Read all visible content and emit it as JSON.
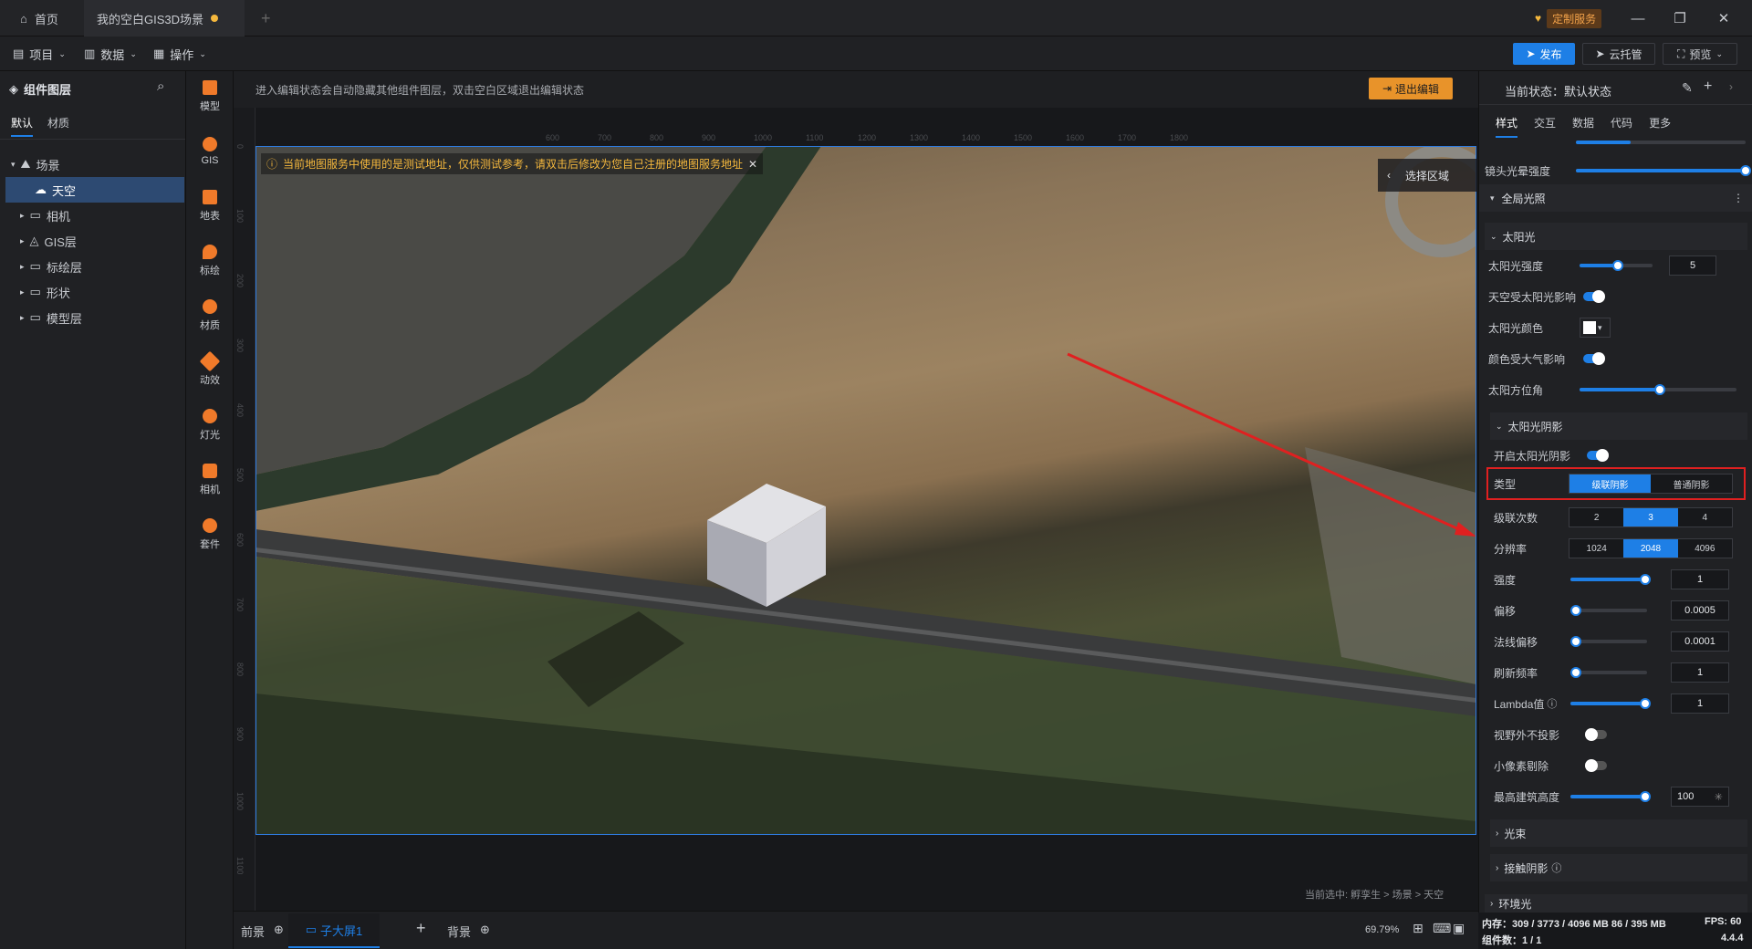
{
  "titlebar": {
    "home_tab": "首页",
    "doc_tab": "我的空白GIS3D场景",
    "custom_service": "定制服务"
  },
  "menubar": {
    "project": "项目",
    "data": "数据",
    "operate": "操作",
    "publish": "发布",
    "cloud": "云托管",
    "preview": "预览"
  },
  "layers": {
    "title": "组件图层",
    "tabs": [
      "默认",
      "材质"
    ],
    "items": [
      {
        "label": "场景"
      },
      {
        "label": "天空"
      },
      {
        "label": "相机"
      },
      {
        "label": "GIS层"
      },
      {
        "label": "标绘层"
      },
      {
        "label": "形状"
      },
      {
        "label": "模型层"
      }
    ]
  },
  "tools": [
    "模型",
    "GIS",
    "地表",
    "标绘",
    "材质",
    "动效",
    "灯光",
    "相机",
    "套件"
  ],
  "canvas": {
    "edit_hint": "进入编辑状态会自动隐藏其他组件图层，双击空白区域退出编辑状态",
    "exit_edit": "退出编辑",
    "warning": "当前地图服务中使用的是测试地址，仅供测试参考，请双击后修改为您自己注册的地图服务地址",
    "select_area": "选择区域",
    "breadcrumb": "当前选中: 孵孪生 > 场景 > 天空",
    "ruler_top": [
      "600",
      "700",
      "800",
      "900",
      "1000",
      "1100",
      "1200",
      "1300",
      "1400",
      "1500",
      "1600",
      "1700",
      "1800"
    ],
    "ruler_left": [
      "0",
      "100",
      "200",
      "300",
      "400",
      "500",
      "600",
      "700",
      "800",
      "900",
      "1000",
      "1100"
    ]
  },
  "bottombar": {
    "front": "前景",
    "screen": "子大屏1",
    "background": "背景",
    "zoom": "69.79%"
  },
  "rightpanel": {
    "state_label": "当前状态：默认状态",
    "tabs": [
      "样式",
      "交互",
      "数据",
      "代码",
      "更多"
    ],
    "lens_flare": "镜头光晕强度",
    "global_light": "全局光照",
    "sun": "太阳光",
    "sun_intensity": "太阳光强度",
    "sun_intensity_value": "5",
    "sky_affect": "天空受太阳光影响",
    "sun_color": "太阳光颜色",
    "color_affect": "颜色受大气影响",
    "sun_azimuth": "太阳方位角",
    "sun_shadow": "太阳光阴影",
    "enable_shadow": "开启太阳光阴影",
    "type": "类型",
    "type_options": [
      "级联阴影",
      "普通阴影"
    ],
    "cascade": "级联次数",
    "cascade_options": [
      "2",
      "3",
      "4"
    ],
    "resolution": "分辨率",
    "resolution_options": [
      "1024",
      "2048",
      "4096"
    ],
    "strength": "强度",
    "strength_value": "1",
    "bias": "偏移",
    "bias_value": "0.0005",
    "normal_bias": "法线偏移",
    "normal_bias_value": "0.0001",
    "refresh": "刷新频率",
    "refresh_value": "1",
    "lambda": "Lambda值",
    "lambda_value": "1",
    "no_shadow_out": "视野外不投影",
    "small_cull": "小像素剔除",
    "max_height": "最高建筑高度",
    "max_height_value": "100",
    "light_beam": "光束",
    "contact_shadow": "接触阴影",
    "env": "环境光"
  },
  "status": {
    "memory": "内存：309 / 3773 / 4096 MB  86 / 395 MB",
    "fps": "FPS: 60",
    "components": "组件数：1 / 1",
    "version": "4.4.4"
  },
  "colors": {
    "accent": "#1e7fe6",
    "warning": "#f5b83d",
    "highlight": "#e02020"
  }
}
